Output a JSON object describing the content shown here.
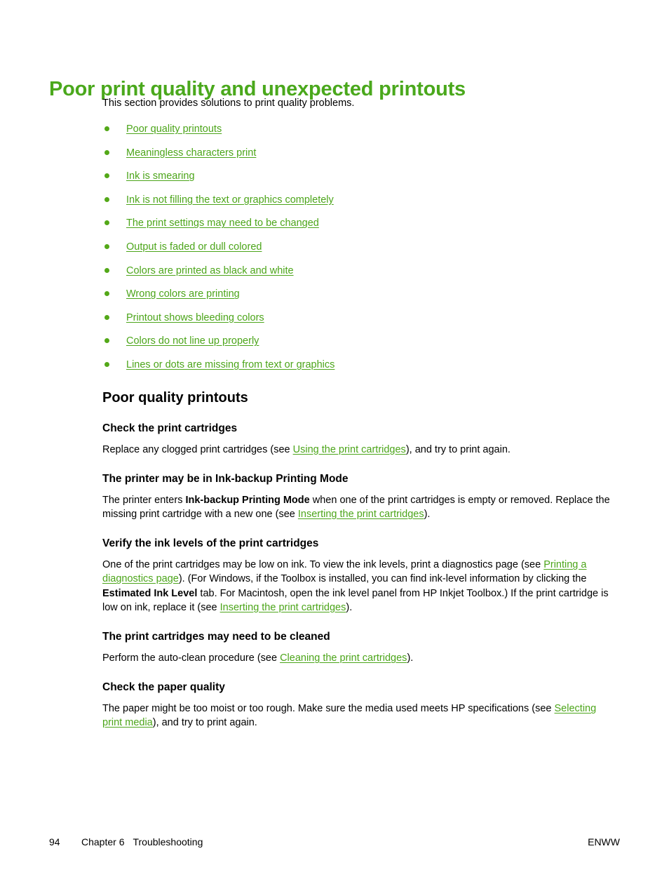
{
  "document": {
    "title": "Poor print quality and unexpected printouts",
    "intro": "This section provides solutions to print quality problems."
  },
  "colors": {
    "title_green": "#4aa81c",
    "link_green": "#4ca51a",
    "bullet_green": "#53a818",
    "body_text": "#000000",
    "page_background": "#ffffff"
  },
  "toc": {
    "items": [
      {
        "label": "Poor quality printouts"
      },
      {
        "label": "Meaningless characters print"
      },
      {
        "label": "Ink is smearing"
      },
      {
        "label": "Ink is not filling the text or graphics completely"
      },
      {
        "label": "The print settings may need to be changed"
      },
      {
        "label": "Output is faded or dull colored"
      },
      {
        "label": "Colors are printed as black and white"
      },
      {
        "label": "Wrong colors are printing"
      },
      {
        "label": "Printout shows bleeding colors"
      },
      {
        "label": "Colors do not line up properly"
      },
      {
        "label": "Lines or dots are missing from text or graphics"
      }
    ]
  },
  "section": {
    "heading": "Poor quality printouts",
    "subsections": [
      {
        "heading": "Check the print cartridges",
        "parts": [
          {
            "text": "Replace any clogged print cartridges (see "
          },
          {
            "link": "Using the print cartridges"
          },
          {
            "text": "), and try to print again."
          }
        ]
      },
      {
        "heading": "The printer may be in Ink-backup Printing Mode",
        "parts": [
          {
            "text": "The printer enters "
          },
          {
            "bold": "Ink-backup Printing Mode"
          },
          {
            "text": " when one of the print cartridges is empty or removed. Replace the missing print cartridge with a new one (see "
          },
          {
            "link": "Inserting the print cartridges"
          },
          {
            "text": ")."
          }
        ]
      },
      {
        "heading": "Verify the ink levels of the print cartridges",
        "parts": [
          {
            "text": "One of the print cartridges may be low on ink. To view the ink levels, print a diagnostics page (see "
          },
          {
            "link": "Printing a diagnostics page"
          },
          {
            "text": "). (For Windows, if the Toolbox is installed, you can find ink-level information by clicking the "
          },
          {
            "bold": "Estimated Ink Level"
          },
          {
            "text": " tab. For Macintosh, open the ink level panel from HP Inkjet Toolbox.) If the print cartridge is low on ink, replace it (see "
          },
          {
            "link": "Inserting the print cartridges"
          },
          {
            "text": ")."
          }
        ]
      },
      {
        "heading": "The print cartridges may need to be cleaned",
        "parts": [
          {
            "text": "Perform the auto-clean procedure (see "
          },
          {
            "link": "Cleaning the print cartridges"
          },
          {
            "text": ")."
          }
        ]
      },
      {
        "heading": "Check the paper quality",
        "parts": [
          {
            "text": "The paper might be too moist or too rough. Make sure the media used meets HP specifications (see "
          },
          {
            "link": "Selecting print media"
          },
          {
            "text": "), and try to print again."
          }
        ]
      }
    ]
  },
  "footer": {
    "page_number": "94",
    "chapter": "Chapter 6",
    "chapter_title": "Troubleshooting",
    "locale": "ENWW"
  }
}
